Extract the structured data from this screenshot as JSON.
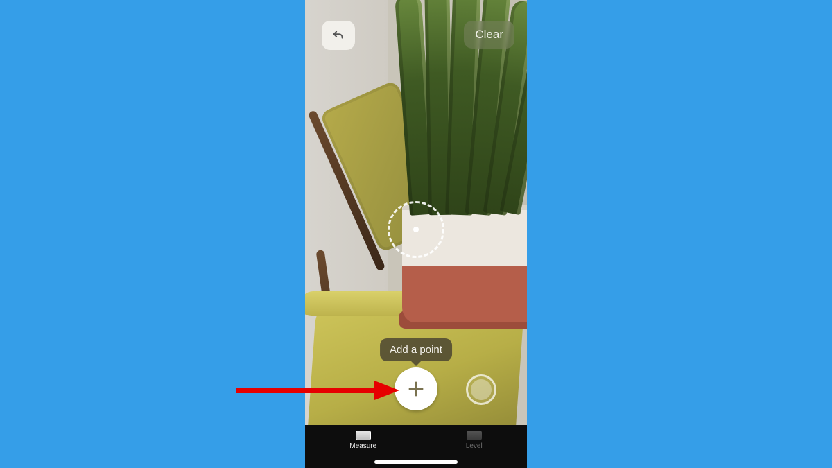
{
  "toolbar": {
    "undo_icon": "undo-icon",
    "clear_label": "Clear"
  },
  "hint": {
    "tooltip_text": "Add a point"
  },
  "tabs": {
    "measure_label": "Measure",
    "level_label": "Level"
  },
  "colors": {
    "accent_arrow": "#e60000",
    "stage_bg": "#359ee8"
  }
}
